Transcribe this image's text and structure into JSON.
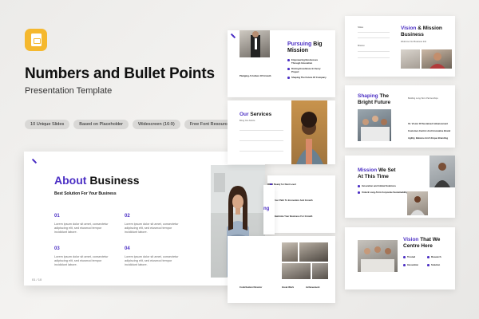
{
  "header": {
    "title": "Numbers and Bullet Points",
    "subtitle": "Presentation Template"
  },
  "tags": [
    "10 Unique Slides",
    "Based on Placeholder",
    "Widescreen (16:9)",
    "Free Font Resources"
  ],
  "main_slide": {
    "title_accent": "About",
    "title_rest": " Business",
    "subtitle": "Best Solution For Your Business",
    "points": [
      {
        "num": "01",
        "text": "Lorem ipsum dolor sit amet, consectetur adipiscing elit, sed eiusmod tempor incididunt labore."
      },
      {
        "num": "02",
        "text": "Lorem ipsum dolor sit amet, consectetur adipiscing elit, sed eiusmod tempor incididunt labore."
      },
      {
        "num": "03",
        "text": "Lorem ipsum dolor sit amet, consectetur adipiscing elit, sed eiusmod tempor incididunt labore."
      },
      {
        "num": "04",
        "text": "Lorem ipsum dolor sit amet, consectetur adipiscing elit, sed eiusmod tempor incididunt labore."
      }
    ],
    "slide_number": "01 / 10"
  },
  "slides": {
    "mission": {
      "title_accent": "Pursuing",
      "title_rest": " Big Mission",
      "left_label": "Pledging A Culture Of Growth",
      "items": [
        "Empowering Businesses Through Innovation",
        "Driving Excellence In Every Project",
        "Shaping The Future Of Company"
      ]
    },
    "vision": {
      "title_accent": "Vision",
      "title_rest": " & Mission",
      "title_line2": "Business",
      "subtitle": "Welcome Our Business Info",
      "small_labels": [
        "Slides",
        "Mission"
      ]
    },
    "services": {
      "title_accent": "Our",
      "title_rest": " Services",
      "subtitle": "Bring Our Advice"
    },
    "shaping": {
      "title_accent": "Shaping",
      "title_rest": " The",
      "title_line2": "Bright Future",
      "subtitle": "Building Long-Term Partnerships",
      "items": [
        "01. Vision Of Sustained Advancement",
        "Customer-Centric And Innovative Brand",
        "Agility, Balance And Unique Branding"
      ]
    },
    "middle": {
      "items": [
        "Ready for Next Level",
        "Your Path To Innovation And Growth",
        "Maximize Your Business For Growth"
      ],
      "partial_title_accent": "ng",
      "partial_title_rest": "h"
    },
    "mission_time": {
      "title_accent": "Mission",
      "title_rest": " We Set",
      "title_line2": "At This Time",
      "items": [
        "Innovation and Global Solutions",
        "Unlock Long-Term Corporate Sustainability"
      ]
    },
    "vision_centre": {
      "title_accent": "Vision",
      "title_rest": " That We",
      "title_line2": "Centre Here",
      "items": [
        "Trusted",
        "Research",
        "Innovation",
        "Solution"
      ]
    },
    "team": {
      "labels": [
        "Contribution Director",
        "Great Work",
        "Achievement"
      ]
    }
  },
  "colors": {
    "accent": "#4b2fc4",
    "tag_bg": "#d9d8d6",
    "background": "#eceae8"
  },
  "icons": [
    "google-slides-icon",
    "brand-logo-icon"
  ]
}
